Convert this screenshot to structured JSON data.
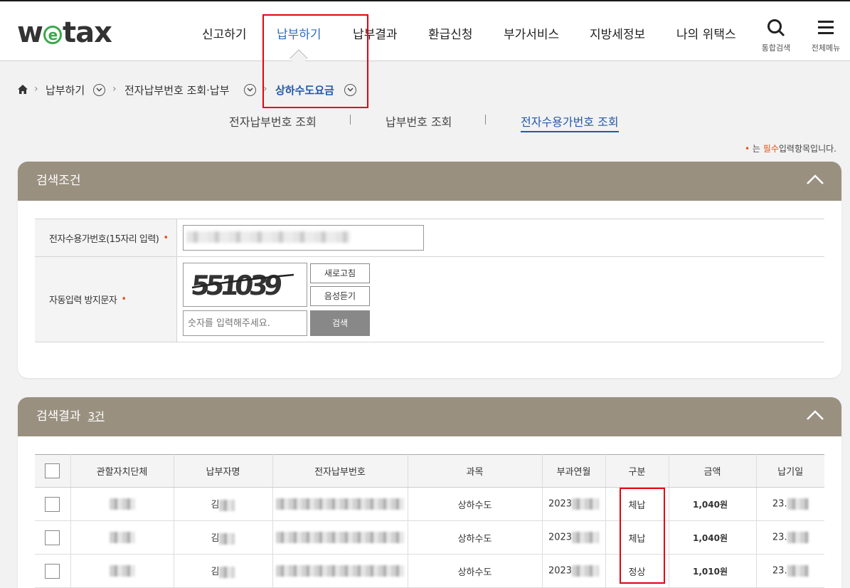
{
  "header": {
    "logo": "wetax",
    "nav": [
      "신고하기",
      "납부하기",
      "납부결과",
      "환급신청",
      "부가서비스",
      "지방세정보",
      "나의 위택스"
    ],
    "active_nav": "납부하기",
    "search_label": "통합검색",
    "menu_label": "전체메뉴"
  },
  "breadcrumb": {
    "items": [
      "납부하기",
      "전자납부번호 조회·납부",
      "상하수도요금"
    ]
  },
  "subtabs": {
    "items": [
      "전자납부번호 조회",
      "납부번호 조회",
      "전자수용가번호 조회"
    ],
    "active": "전자수용가번호 조회"
  },
  "required_note": {
    "dot": "•",
    "prefix": "는",
    "emph": "필수",
    "suffix": "입력항목입니다."
  },
  "search_panel": {
    "title": "검색조건",
    "fields": {
      "account_label": "전자수용가번호(15자리 입력)",
      "captcha_label": "자동입력 방지문자",
      "required_mark": "•"
    },
    "captcha_text": "551039",
    "refresh_button": "새로고침",
    "audio_button": "음성듣기",
    "captcha_placeholder": "숫자를 입력해주세요.",
    "search_button": "검색"
  },
  "results_panel": {
    "title": "검색결과",
    "count": "3건",
    "columns": [
      "관할자치단체",
      "납부자명",
      "전자납부번호",
      "과목",
      "부과연월",
      "구분",
      "금액",
      "납기일"
    ],
    "rows": [
      {
        "name": "김",
        "subject": "상하수도",
        "ym": "2023",
        "type": "체납",
        "amount": "1,040원",
        "due": "23."
      },
      {
        "name": "김",
        "subject": "상하수도",
        "ym": "2023",
        "type": "체납",
        "amount": "1,040원",
        "due": "23."
      },
      {
        "name": "김",
        "subject": "상하수도",
        "ym": "2023",
        "type": "정상",
        "amount": "1,010원",
        "due": "23."
      }
    ]
  },
  "colors": {
    "accent": "#2359a8",
    "panel_header": "#9a9080",
    "highlight": "#e60012",
    "required": "#e0551b"
  }
}
